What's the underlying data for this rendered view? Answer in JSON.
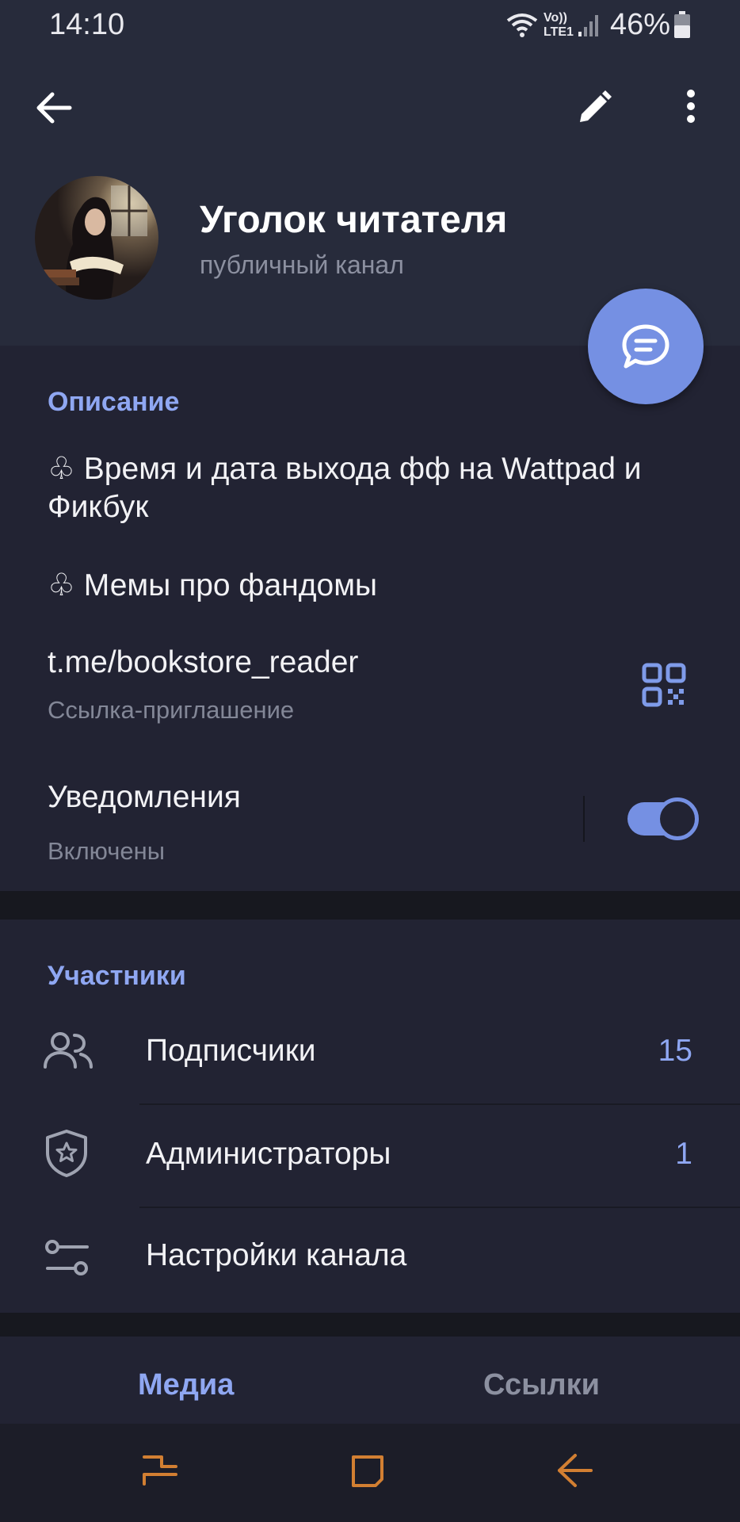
{
  "status_bar": {
    "time": "14:10",
    "network": "Vo)) LTE1",
    "battery_percent": "46%"
  },
  "header": {
    "back_icon": "arrow-left-icon",
    "edit_icon": "pencil-icon",
    "menu_icon": "more-vertical-icon",
    "title": "Уголок читателя",
    "subtitle": "публичный канал",
    "fab_icon": "chat-bubble-icon"
  },
  "info": {
    "description_label": "Описание",
    "description_lines": [
      "♧ Время и дата выхода фф на Wattpad и Фикбук",
      "♧ Мемы про фандомы"
    ],
    "link": "t.me/bookstore_reader",
    "link_caption": "Ссылка-приглашение",
    "qr_icon": "qr-code-icon",
    "notifications_label": "Уведомления",
    "notifications_status": "Включены",
    "notifications_enabled": true
  },
  "members": {
    "section_label": "Участники",
    "rows": [
      {
        "label": "Подписчики",
        "count": "15",
        "icon": "users-icon"
      },
      {
        "label": "Администраторы",
        "count": "1",
        "icon": "shield-star-icon"
      },
      {
        "label": "Настройки канала",
        "count": "",
        "icon": "sliders-icon"
      }
    ]
  },
  "tabs": [
    {
      "label": "Медиа",
      "active": true
    },
    {
      "label": "Ссылки",
      "active": false
    }
  ],
  "nav_bar": {
    "recents_icon": "recents-icon",
    "home_icon": "home-icon",
    "back_icon": "nav-back-icon"
  },
  "colors": {
    "accent": "#7590e3",
    "accent_text": "#8fa7f2",
    "header_bg": "#272b3b",
    "section_bg": "#222333",
    "nav_icon": "#d27f32"
  }
}
